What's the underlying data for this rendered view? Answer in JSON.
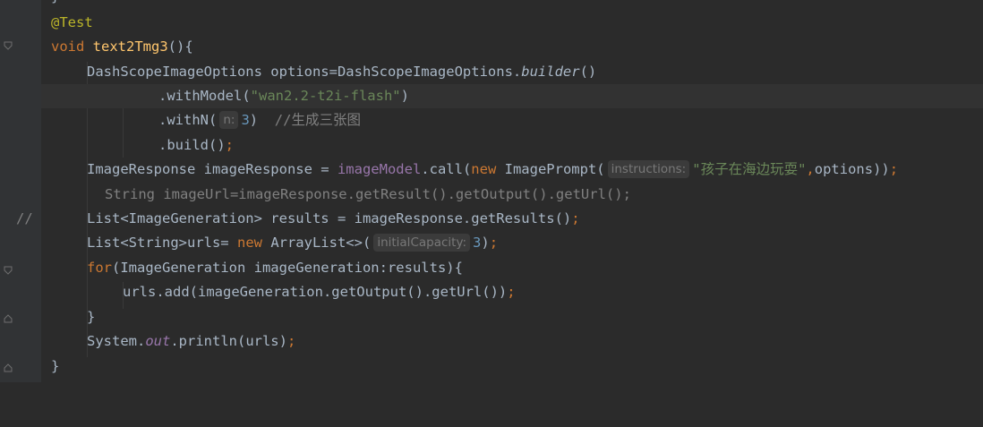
{
  "editor": {
    "lines": {
      "l0": {
        "brace": "}"
      },
      "l1": {
        "annotation": "@Test"
      },
      "l2": {
        "kw_void": "void",
        "method_name": "text2Tmg3",
        "rest": "(){"
      },
      "l3": {
        "a": "DashScopeImageOptions options=DashScopeImageOptions.",
        "builder": "builder",
        "b": "()"
      },
      "l4": {
        "a": ".withModel(",
        "str": "\"wan2.2-t2i-flash\"",
        "b": ")"
      },
      "l5": {
        "a": ".withN(",
        "hint": "n:",
        "num": "3",
        "b": ")  ",
        "comment": "//生成三张图"
      },
      "l6": {
        "a": ".build()",
        "semi": ";"
      },
      "l7": {
        "a": "ImageResponse imageResponse = ",
        "field": "imageModel",
        "b": ".call(",
        "kw_new": "new",
        "c": " ImagePrompt(",
        "hint": "instructions:",
        "str": "\"孩子在海边玩耍\"",
        "comma": ",",
        "d": "options))",
        "semi": ";"
      },
      "l8": {
        "marker": "//",
        "comment": "String imageUrl=imageResponse.getResult().getOutput().getUrl();"
      },
      "l9": {
        "a": "List<ImageGeneration> results = imageResponse.getResults()",
        "semi": ";"
      },
      "l10": {
        "a": "List<String>urls= ",
        "kw_new": "new",
        "b": " ArrayList<>(",
        "hint": "initialCapacity:",
        "num": "3",
        "c": ")",
        "semi": ";"
      },
      "l11": {
        "kw_for": "for",
        "a": "(ImageGeneration imageGeneration:results){"
      },
      "l12": {
        "a": "urls.add(imageGeneration.getOutput().getUrl())",
        "semi": ";"
      },
      "l13": {
        "brace": "}"
      },
      "l14": {
        "a": "System.",
        "out": "out",
        "b": ".println(urls)",
        "semi": ";"
      },
      "l15": {
        "brace": "}"
      }
    }
  },
  "colors": {
    "background": "#2b2b2b",
    "gutter": "#313335",
    "keyword": "#cc7832",
    "annotation": "#bbb529",
    "method_decl": "#ffc66d",
    "string": "#6a8759",
    "number": "#6897bb",
    "comment": "#808080",
    "field": "#9876aa",
    "text": "#a9b7c6"
  },
  "icons": [
    "fold-marker-icon"
  ]
}
